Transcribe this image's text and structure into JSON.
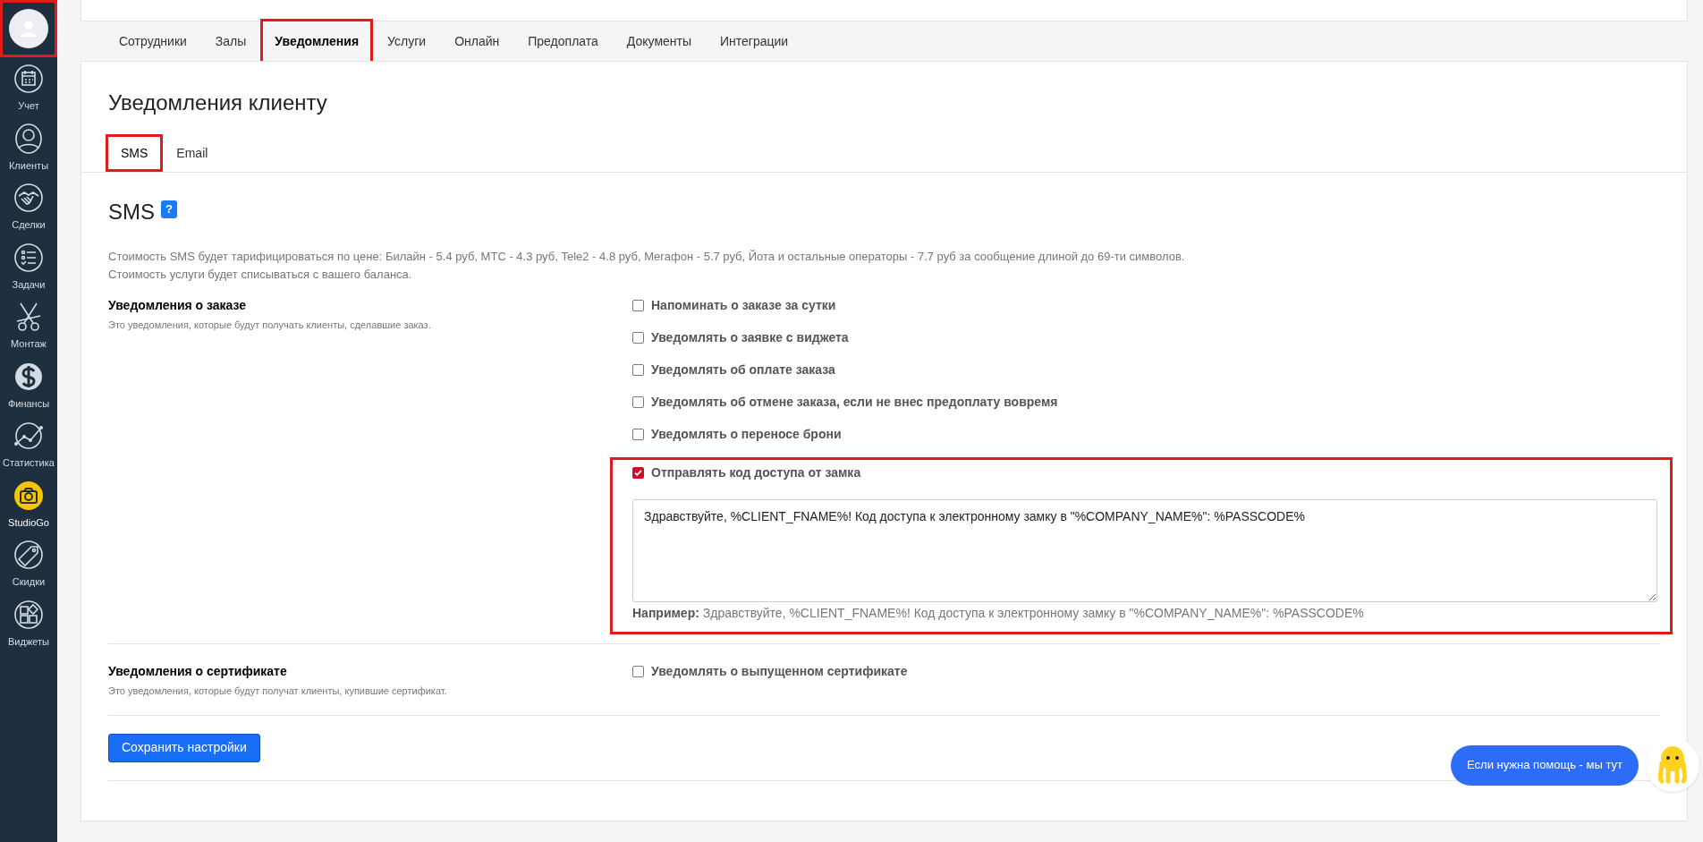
{
  "sidebar": {
    "avatar": {
      "highlighted": true
    },
    "items": [
      {
        "label": "Учет",
        "selected": false
      },
      {
        "label": "Клиенты",
        "selected": false
      },
      {
        "label": "Сделки",
        "selected": false
      },
      {
        "label": "Задачи",
        "selected": false
      },
      {
        "label": "Монтаж",
        "selected": false
      },
      {
        "label": "Финансы",
        "selected": false
      },
      {
        "label": "Статистика",
        "selected": false
      },
      {
        "label": "StudioGo",
        "selected": true
      },
      {
        "label": "Скидки",
        "selected": false
      },
      {
        "label": "Виджеты",
        "selected": false
      }
    ]
  },
  "tabs": [
    {
      "label": "Сотрудники",
      "selected": false,
      "highlighted": false
    },
    {
      "label": "Залы",
      "selected": false,
      "highlighted": false
    },
    {
      "label": "Уведомления",
      "selected": true,
      "highlighted": true
    },
    {
      "label": "Услуги",
      "selected": false,
      "highlighted": false
    },
    {
      "label": "Онлайн",
      "selected": false,
      "highlighted": false
    },
    {
      "label": "Предоплата",
      "selected": false,
      "highlighted": false
    },
    {
      "label": "Документы",
      "selected": false,
      "highlighted": false
    },
    {
      "label": "Интеграции",
      "selected": false,
      "highlighted": false
    }
  ],
  "page_title": "Уведомления клиенту",
  "subtabs": [
    {
      "label": "SMS",
      "selected": true,
      "highlighted": true
    },
    {
      "label": "Email",
      "selected": false,
      "highlighted": false
    }
  ],
  "section_title": "SMS",
  "help_badge": "?",
  "description": [
    "Стоимость SMS будет тарифицироваться по цене: Билайн - 5.4 руб, МТС - 4.3 руб, Tele2 - 4.8 руб, Мегафон - 5.7 руб, Йота и остальные операторы - 7.7 руб за сообщение длиной до 69-ти символов.",
    "Стоимость услуги будет списываться с вашего баланса."
  ],
  "groups": [
    {
      "title": "Уведомления о заказе",
      "subtitle": "Это уведомления, которые будут получать клиенты, сделавшие заказ.",
      "options": [
        {
          "label": "Напоминать о заказе за сутки",
          "checked": false,
          "highlighted": false
        },
        {
          "label": "Уведомлять о заявке с виджета",
          "checked": false,
          "highlighted": false
        },
        {
          "label": "Уведомлять об оплате заказа",
          "checked": false,
          "highlighted": false
        },
        {
          "label": "Уведомлять об отмене заказа, если не внес предоплату вовремя",
          "checked": false,
          "highlighted": false
        },
        {
          "label": "Уведомлять о переносе брони",
          "checked": false,
          "highlighted": false
        },
        {
          "label": "Отправлять код доступа от замка",
          "checked": true,
          "highlighted": true,
          "template": "Здравствуйте, %CLIENT_FNAME%! Код доступа к электронному замку в \"%COMPANY_NAME%\": %PASSCODE%",
          "example_label": "Например:",
          "example": "Здравствуйте, %CLIENT_FNAME%! Код доступа к электронному замку в \"%COMPANY_NAME%\": %PASSCODE%"
        }
      ]
    },
    {
      "title": "Уведомления о сертификате",
      "subtitle": "Это уведомления, которые будут получат клиенты, купившие сертификат.",
      "options": [
        {
          "label": "Уведомлять о выпущенном сертификате",
          "checked": false,
          "highlighted": false
        }
      ]
    }
  ],
  "save_button": "Сохранить настройки",
  "chat_bubble": "Если нужна помощь - мы тут"
}
